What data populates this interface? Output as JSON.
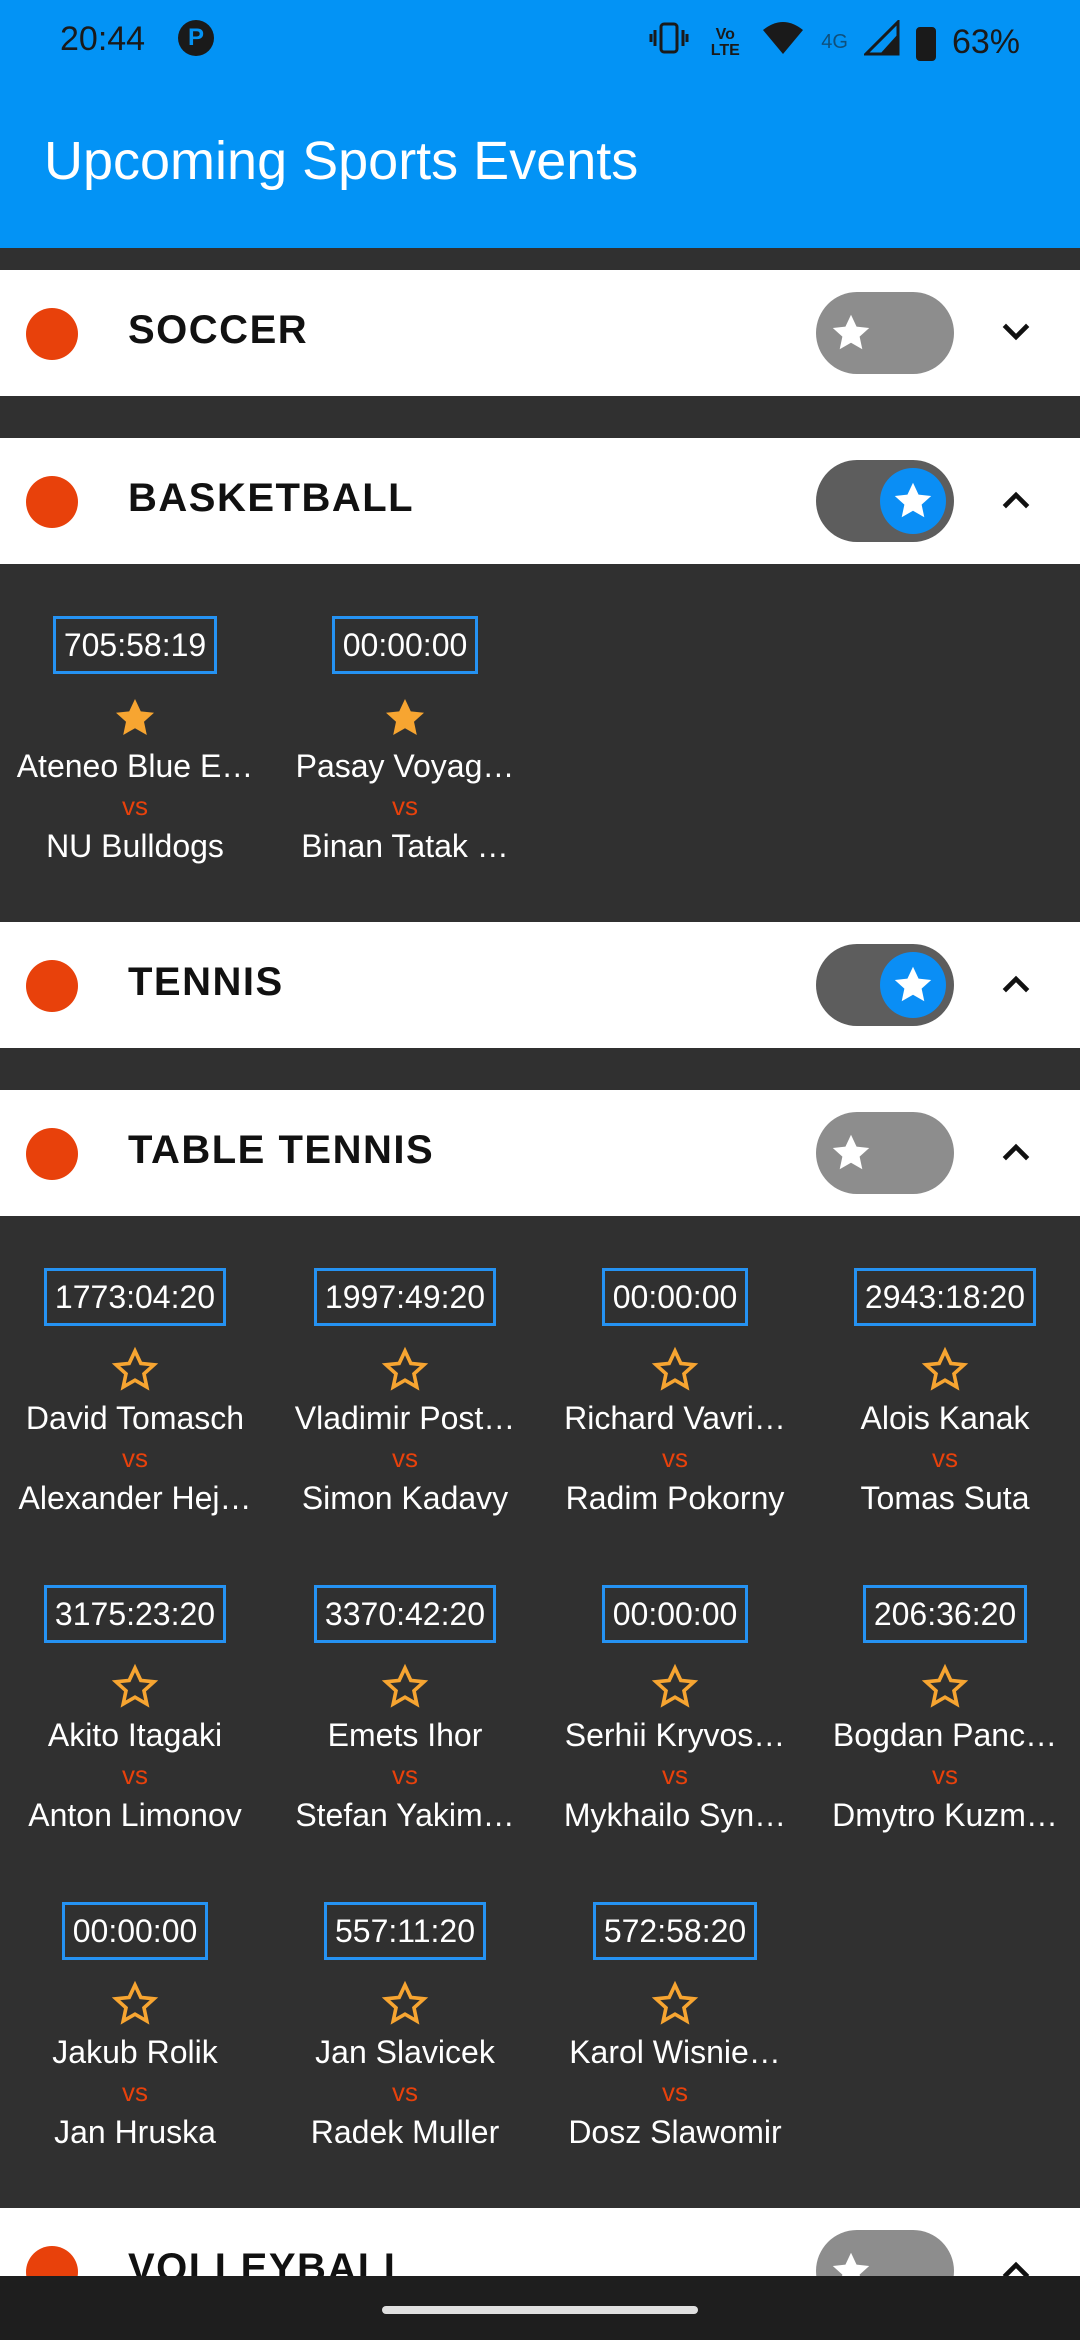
{
  "status": {
    "time": "20:44",
    "app_badge": "P",
    "volte": "Vo\nLTE",
    "network": "4G",
    "battery": "63%"
  },
  "app": {
    "title": "Upcoming Sports Events"
  },
  "colors": {
    "app_bar": "#0393f5",
    "accent_blue": "#2592f2",
    "sport_dot": "#e8410b",
    "star": "#f7a531"
  },
  "sections": [
    {
      "name": "SOCCER",
      "favorite": false,
      "expanded": false
    },
    {
      "name": "BASKETBALL",
      "favorite": true,
      "expanded": true,
      "events": [
        {
          "timer": "705:58:19",
          "starred": true,
          "team_a": "Ateneo Blue E…",
          "vs": "vs",
          "team_b": "NU Bulldogs"
        },
        {
          "timer": "00:00:00",
          "starred": true,
          "team_a": "Pasay Voyag…",
          "vs": "vs",
          "team_b": "Binan Tatak …"
        }
      ]
    },
    {
      "name": "TENNIS",
      "favorite": true,
      "expanded": true
    },
    {
      "name": "TABLE TENNIS",
      "favorite": false,
      "expanded": true,
      "events": [
        {
          "timer": "1773:04:20",
          "starred": false,
          "team_a": "David Tomasch",
          "vs": "vs",
          "team_b": "Alexander Hej…"
        },
        {
          "timer": "1997:49:20",
          "starred": false,
          "team_a": "Vladimir Post…",
          "vs": "vs",
          "team_b": "Simon Kadavy"
        },
        {
          "timer": "00:00:00",
          "starred": false,
          "team_a": "Richard Vavri…",
          "vs": "vs",
          "team_b": "Radim Pokorny"
        },
        {
          "timer": "2943:18:20",
          "starred": false,
          "team_a": "Alois Kanak",
          "vs": "vs",
          "team_b": "Tomas Suta"
        },
        {
          "timer": "3175:23:20",
          "starred": false,
          "team_a": "Akito Itagaki",
          "vs": "vs",
          "team_b": "Anton Limonov"
        },
        {
          "timer": "3370:42:20",
          "starred": false,
          "team_a": "Emets Ihor",
          "vs": "vs",
          "team_b": "Stefan Yakim…"
        },
        {
          "timer": "00:00:00",
          "starred": false,
          "team_a": "Serhii Kryvos…",
          "vs": "vs",
          "team_b": "Mykhailo Syn…"
        },
        {
          "timer": "206:36:20",
          "starred": false,
          "team_a": "Bogdan Panc…",
          "vs": "vs",
          "team_b": "Dmytro Kuzm…"
        },
        {
          "timer": "00:00:00",
          "starred": false,
          "team_a": "Jakub Rolik",
          "vs": "vs",
          "team_b": "Jan Hruska"
        },
        {
          "timer": "557:11:20",
          "starred": false,
          "team_a": "Jan Slavicek",
          "vs": "vs",
          "team_b": "Radek Muller"
        },
        {
          "timer": "572:58:20",
          "starred": false,
          "team_a": "Karol Wisnie…",
          "vs": "vs",
          "team_b": "Dosz Slawomir"
        }
      ]
    },
    {
      "name": "VOLLEYBALL",
      "favorite": false,
      "expanded": true
    }
  ]
}
